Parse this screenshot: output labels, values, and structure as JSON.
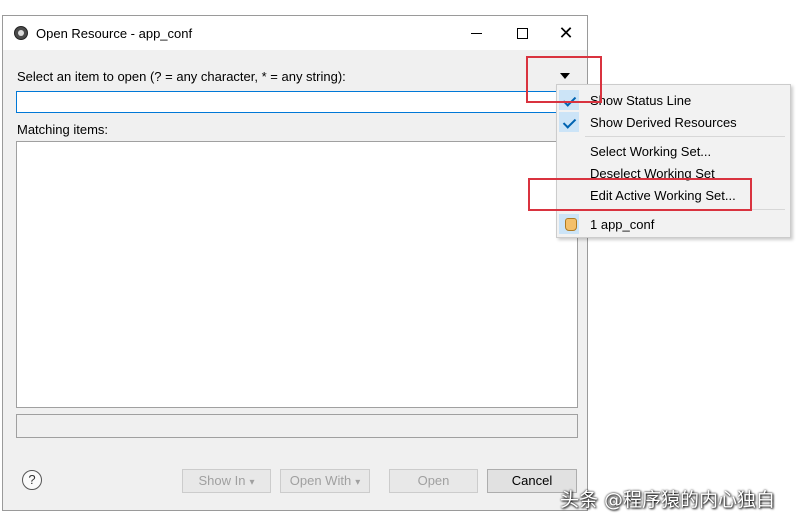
{
  "window": {
    "title": "Open Resource - app_conf",
    "close_glyph": "✕"
  },
  "search": {
    "prompt": "Select an item to open (? = any character, * = any string):",
    "value": "",
    "placeholder": ""
  },
  "results": {
    "label": "Matching items:",
    "items": []
  },
  "status_line": "",
  "buttons": {
    "help": "?",
    "show_in": "Show In",
    "open_with": "Open With",
    "open": "Open",
    "cancel": "Cancel",
    "dropdown_caret": "▾"
  },
  "menu": {
    "items": [
      {
        "label": "Show Status Line",
        "checked": true
      },
      {
        "label": "Show Derived Resources",
        "checked": true
      },
      {
        "label": "Select Working Set..."
      },
      {
        "label": "Deselect Working Set"
      },
      {
        "label": "Edit Active Working Set..."
      },
      {
        "label": "1 app_conf"
      }
    ]
  },
  "watermark": "头条 @程序猿的内心独白",
  "colors": {
    "highlight": "#d9333f",
    "input_focus": "#0078d7",
    "check": "#0063b1"
  },
  "icons": {
    "app": "eclipse-icon",
    "menu_trigger": "triangle-down-icon",
    "history": "hand-pointer-icon"
  }
}
